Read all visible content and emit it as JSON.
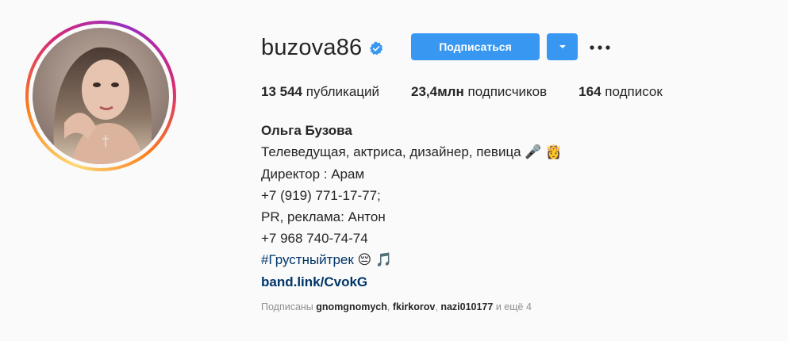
{
  "profile": {
    "username": "buzova86",
    "follow_label": "Подписаться",
    "stats": {
      "posts_count": "13 544",
      "posts_label": "публикаций",
      "followers_count": "23,4млн",
      "followers_label": "подписчиков",
      "following_count": "164",
      "following_label": "подписок"
    },
    "bio": {
      "name": "Ольга Бузова",
      "line1": "Телеведущая, актриса, дизайнер, певица",
      "line1_emoji1": "🎤",
      "line1_emoji2": "👸",
      "line2": "Директор : Арам",
      "line3": "+7 (919) 771-17-77;",
      "line4": "PR, реклама: Антон",
      "line5": "+7 968 740-74-74",
      "hashtag": "#Грустныйтрек",
      "hashtag_emoji1": "😔",
      "hashtag_emoji2": "🎵",
      "link": "band.link/CvokG"
    },
    "followed_by": {
      "prefix": "Подписаны",
      "accounts": [
        "gnomgnomych",
        "fkirkorov",
        "nazi010177"
      ],
      "separator": ",",
      "suffix_word": "и",
      "more": "ещё 4"
    }
  },
  "colors": {
    "accent": "#3897f0",
    "verified": "#3897f0",
    "link": "#003569",
    "muted": "#8e8e8e",
    "text": "#262626"
  },
  "icons": {
    "verified": "verified-badge-icon",
    "dropdown": "chevron-down-icon",
    "more": "more-options-icon"
  }
}
